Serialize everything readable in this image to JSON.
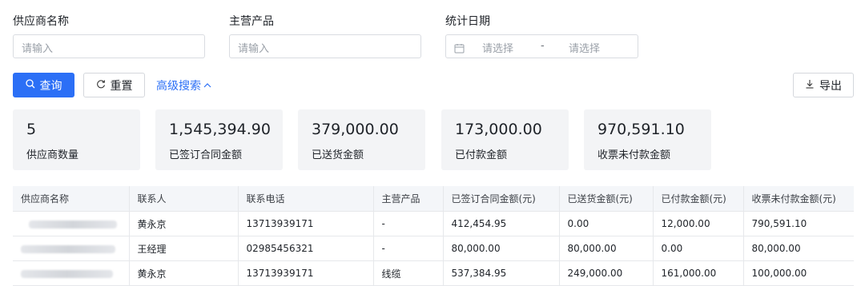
{
  "filters": {
    "supplier_name": {
      "label": "供应商名称",
      "placeholder": "请输入"
    },
    "main_product": {
      "label": "主营产品",
      "placeholder": "请输入"
    },
    "stat_date": {
      "label": "统计日期",
      "start_placeholder": "请选择",
      "separator": "-",
      "end_placeholder": "请选择"
    }
  },
  "actions": {
    "query": "查询",
    "reset": "重置",
    "advanced": "高级搜索",
    "export": "导出"
  },
  "stats": [
    {
      "value": "5",
      "label": "供应商数量"
    },
    {
      "value": "1,545,394.90",
      "label": "已签订合同金额"
    },
    {
      "value": "379,000.00",
      "label": "已送货金额"
    },
    {
      "value": "173,000.00",
      "label": "已付款金额"
    },
    {
      "value": "970,591.10",
      "label": "收票未付款金额"
    }
  ],
  "table": {
    "columns": [
      "供应商名称",
      "联系人",
      "联系电话",
      "主营产品",
      "已签订合同金额(元)",
      "已送货金额(元)",
      "已付款金额(元)",
      "收票未付款金额(元)"
    ],
    "rows": [
      {
        "contact": "黄永京",
        "phone": "13713939171",
        "product": "-",
        "contract": "412,454.95",
        "delivered": "0.00",
        "paid": "12,000.00",
        "unpaid": "790,591.10"
      },
      {
        "contact": "王经理",
        "phone": "02985456321",
        "product": "-",
        "contract": "80,000.00",
        "delivered": "80,000.00",
        "paid": "0.00",
        "unpaid": "80,000.00"
      },
      {
        "contact": "黄永京",
        "phone": "13713939171",
        "product": "线缆",
        "contract": "537,384.95",
        "delivered": "249,000.00",
        "paid": "161,000.00",
        "unpaid": "100,000.00"
      }
    ]
  },
  "colors": {
    "primary": "#2b6ff6",
    "link": "#2b6ff6",
    "card_bg": "#f3f4f6"
  }
}
